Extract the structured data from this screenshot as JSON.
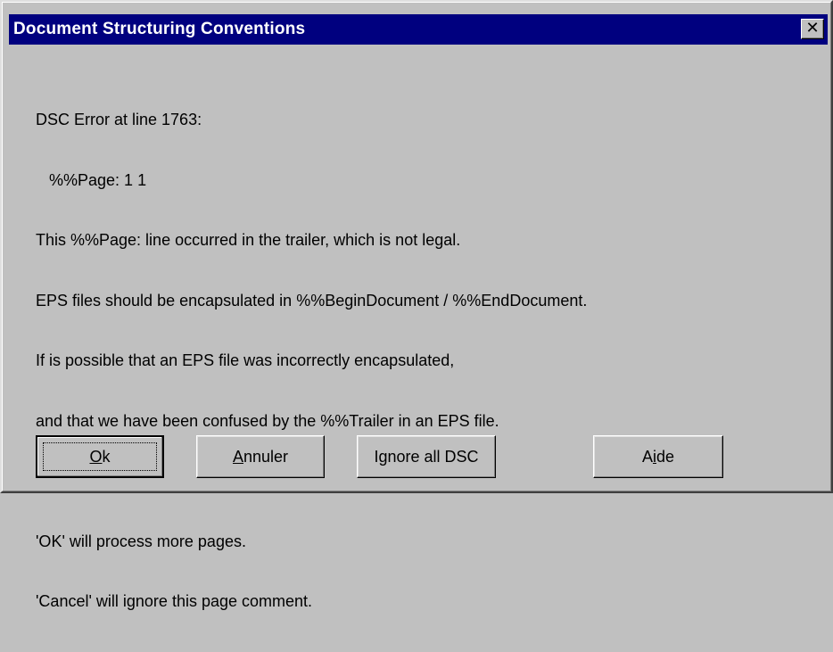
{
  "window": {
    "title": "Document Structuring Conventions",
    "close_glyph": "✕"
  },
  "message": {
    "lines": [
      "DSC Error at line 1763:",
      "   %%Page: 1 1",
      "This %%Page: line occurred in the trailer, which is not legal.",
      "EPS files should be encapsulated in %%BeginDocument / %%EndDocument.",
      "If is possible that an EPS file was incorrectly encapsulated,",
      "and that we have been confused by the %%Trailer in an EPS file.",
      "",
      "'OK' will process more pages.",
      "'Cancel' will ignore this page comment."
    ]
  },
  "buttons": {
    "ok": {
      "mnemonic": "O",
      "rest": "k"
    },
    "annuler": {
      "mnemonic": "A",
      "rest": "nnuler"
    },
    "ignore_all": {
      "label": "Ignore all DSC"
    },
    "aide": {
      "before": "A",
      "mnemonic": "i",
      "rest": "de"
    }
  },
  "colors": {
    "titlebar": "#00007f",
    "face": "#c0c0c0"
  },
  "icons": {
    "close": "close-icon"
  }
}
